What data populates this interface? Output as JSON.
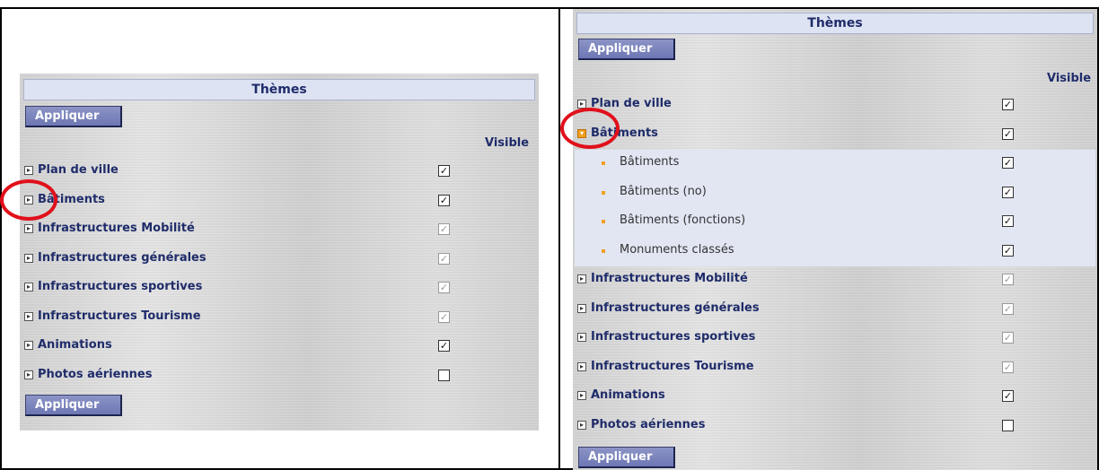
{
  "left": {
    "header_title": "Thèmes",
    "apply_top": "Appliquer",
    "apply_bottom": "Appliquer",
    "visible_label": "Visible",
    "rows": [
      {
        "label": "Plan de ville",
        "checked": true,
        "disabled": false,
        "expanded": false
      },
      {
        "label": "Bâtiments",
        "checked": true,
        "disabled": false,
        "expanded": false
      },
      {
        "label": "Infrastructures Mobilité",
        "checked": true,
        "disabled": true,
        "expanded": false
      },
      {
        "label": "Infrastructures générales",
        "checked": true,
        "disabled": true,
        "expanded": false
      },
      {
        "label": "Infrastructures sportives",
        "checked": true,
        "disabled": true,
        "expanded": false
      },
      {
        "label": "Infrastructures Tourisme",
        "checked": true,
        "disabled": true,
        "expanded": false
      },
      {
        "label": "Animations",
        "checked": true,
        "disabled": false,
        "expanded": false
      },
      {
        "label": "Photos aériennes",
        "checked": false,
        "disabled": false,
        "expanded": false
      }
    ]
  },
  "right": {
    "header_title": "Thèmes",
    "apply_top": "Appliquer",
    "apply_bottom": "Appliquer",
    "visible_label": "Visible",
    "rows": [
      {
        "label": "Plan de ville",
        "checked": true,
        "disabled": false,
        "expanded": false
      },
      {
        "label": "Bâtiments",
        "checked": true,
        "disabled": false,
        "expanded": true
      },
      {
        "label": "Bâtiments",
        "checked": true,
        "disabled": false,
        "sub": true
      },
      {
        "label": "Bâtiments (no)",
        "checked": true,
        "disabled": false,
        "sub": true
      },
      {
        "label": "Bâtiments (fonctions)",
        "checked": true,
        "disabled": false,
        "sub": true
      },
      {
        "label": "Monuments classés",
        "checked": true,
        "disabled": false,
        "sub": true
      },
      {
        "label": "Infrastructures Mobilité",
        "checked": true,
        "disabled": true,
        "expanded": false
      },
      {
        "label": "Infrastructures générales",
        "checked": true,
        "disabled": true,
        "expanded": false
      },
      {
        "label": "Infrastructures sportives",
        "checked": true,
        "disabled": true,
        "expanded": false
      },
      {
        "label": "Infrastructures Tourisme",
        "checked": true,
        "disabled": true,
        "expanded": false
      },
      {
        "label": "Animations",
        "checked": true,
        "disabled": false,
        "expanded": false
      },
      {
        "label": "Photos aériennes",
        "checked": false,
        "disabled": false,
        "expanded": false
      }
    ]
  },
  "colors": {
    "header_bg": "#dde3f3",
    "label_text": "#1f2c6a",
    "button_bg": "#7a83bd",
    "highlight_circle": "#e0101b",
    "sub_row_bg": "#e2e6f3",
    "expander_open": "#f0a020"
  }
}
